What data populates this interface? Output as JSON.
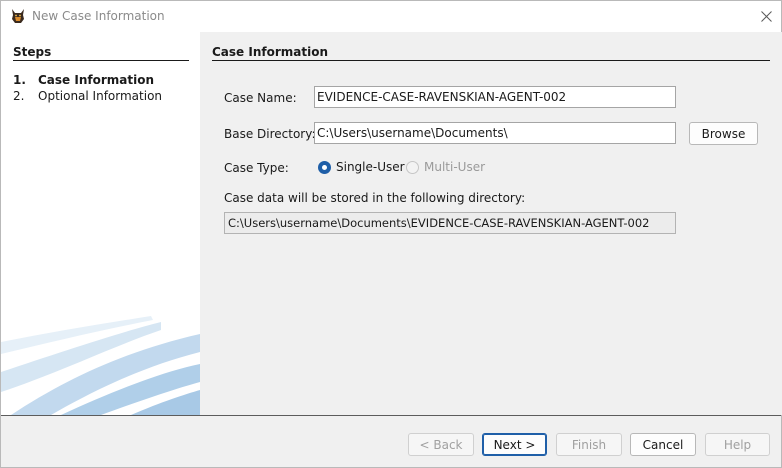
{
  "window": {
    "title": "New Case Information"
  },
  "steps": {
    "title": "Steps",
    "items": [
      {
        "number": "1.",
        "label": "Case Information",
        "active": true
      },
      {
        "number": "2.",
        "label": "Optional Information",
        "active": false
      }
    ]
  },
  "form": {
    "section_title": "Case Information",
    "case_name": {
      "label": "Case Name:",
      "value": "EVIDENCE-CASE-RAVENSKIAN-AGENT-002"
    },
    "base_directory": {
      "label": "Base Directory:",
      "value": "C:\\Users\\username\\Documents\\",
      "browse_label": "Browse"
    },
    "case_type": {
      "label": "Case Type:",
      "options": [
        {
          "label": "Single-User",
          "selected": true,
          "enabled": true
        },
        {
          "label": "Multi-User",
          "selected": false,
          "enabled": false
        }
      ]
    },
    "storage_note": "Case data will be stored in the following directory:",
    "storage_path": "C:\\Users\\username\\Documents\\EVIDENCE-CASE-RAVENSKIAN-AGENT-002"
  },
  "footer": {
    "back_label": "< Back",
    "next_label": "Next >",
    "finish_label": "Finish",
    "cancel_label": "Cancel",
    "help_label": "Help"
  },
  "icons": {
    "app": "dog-app-icon",
    "close": "close-icon"
  },
  "colors": {
    "accent": "#1f5fa8",
    "pane_bg": "#ffffff",
    "dialog_bg": "#f0f0f0"
  }
}
